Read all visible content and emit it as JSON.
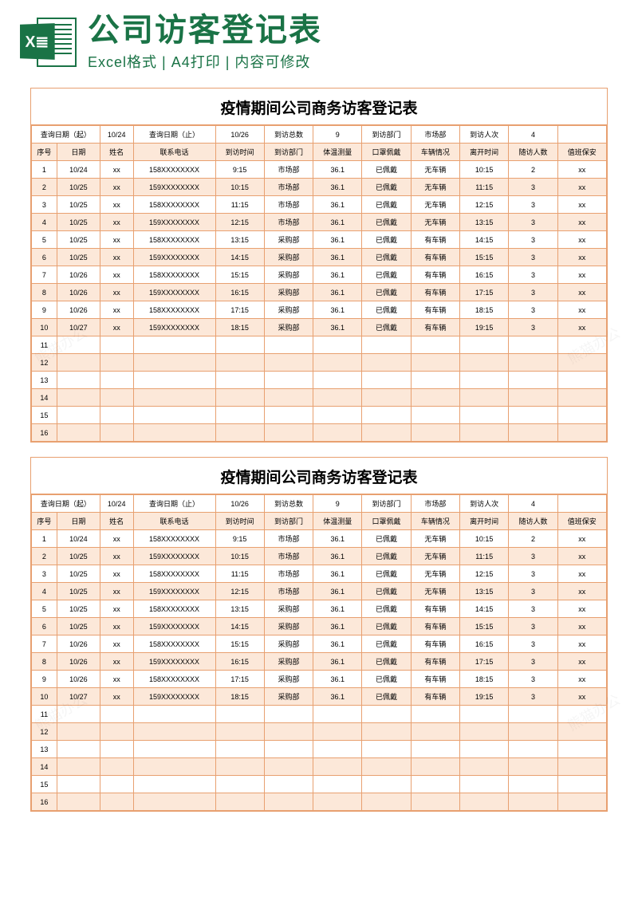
{
  "header": {
    "icon_letter": "X≣",
    "main_title": "公司访客登记表",
    "sub_title": "Excel格式 | A4打印 | 内容可修改"
  },
  "sheet": {
    "title": "疫情期间公司商务访客登记表",
    "summary": {
      "query_start_label": "查询日期（起）",
      "query_start": "10/24",
      "query_end_label": "查询日期（止）",
      "query_end": "10/26",
      "total_visits_label": "到访总数",
      "total_visits": "9",
      "visit_dept_label": "到访部门",
      "visit_dept": "市场部",
      "visit_count_label": "到访人次",
      "visit_count": "4"
    },
    "columns": {
      "seq": "序号",
      "date": "日期",
      "name": "姓名",
      "phone": "联系电话",
      "arrive": "到访时间",
      "dept": "到访部门",
      "temp": "体温测量",
      "mask": "口罩佩戴",
      "car": "车辆情况",
      "leave": "离开时间",
      "ppl": "随访人数",
      "guard": "值班保安"
    },
    "rows": [
      {
        "seq": "1",
        "date": "10/24",
        "name": "xx",
        "phone": "158XXXXXXXX",
        "arrive": "9:15",
        "dept": "市场部",
        "temp": "36.1",
        "mask": "已佩戴",
        "car": "无车辆",
        "leave": "10:15",
        "ppl": "2",
        "guard": "xx"
      },
      {
        "seq": "2",
        "date": "10/25",
        "name": "xx",
        "phone": "159XXXXXXXX",
        "arrive": "10:15",
        "dept": "市场部",
        "temp": "36.1",
        "mask": "已佩戴",
        "car": "无车辆",
        "leave": "11:15",
        "ppl": "3",
        "guard": "xx"
      },
      {
        "seq": "3",
        "date": "10/25",
        "name": "xx",
        "phone": "158XXXXXXXX",
        "arrive": "11:15",
        "dept": "市场部",
        "temp": "36.1",
        "mask": "已佩戴",
        "car": "无车辆",
        "leave": "12:15",
        "ppl": "3",
        "guard": "xx"
      },
      {
        "seq": "4",
        "date": "10/25",
        "name": "xx",
        "phone": "159XXXXXXXX",
        "arrive": "12:15",
        "dept": "市场部",
        "temp": "36.1",
        "mask": "已佩戴",
        "car": "无车辆",
        "leave": "13:15",
        "ppl": "3",
        "guard": "xx"
      },
      {
        "seq": "5",
        "date": "10/25",
        "name": "xx",
        "phone": "158XXXXXXXX",
        "arrive": "13:15",
        "dept": "采购部",
        "temp": "36.1",
        "mask": "已佩戴",
        "car": "有车辆",
        "leave": "14:15",
        "ppl": "3",
        "guard": "xx"
      },
      {
        "seq": "6",
        "date": "10/25",
        "name": "xx",
        "phone": "159XXXXXXXX",
        "arrive": "14:15",
        "dept": "采购部",
        "temp": "36.1",
        "mask": "已佩戴",
        "car": "有车辆",
        "leave": "15:15",
        "ppl": "3",
        "guard": "xx"
      },
      {
        "seq": "7",
        "date": "10/26",
        "name": "xx",
        "phone": "158XXXXXXXX",
        "arrive": "15:15",
        "dept": "采购部",
        "temp": "36.1",
        "mask": "已佩戴",
        "car": "有车辆",
        "leave": "16:15",
        "ppl": "3",
        "guard": "xx"
      },
      {
        "seq": "8",
        "date": "10/26",
        "name": "xx",
        "phone": "159XXXXXXXX",
        "arrive": "16:15",
        "dept": "采购部",
        "temp": "36.1",
        "mask": "已佩戴",
        "car": "有车辆",
        "leave": "17:15",
        "ppl": "3",
        "guard": "xx"
      },
      {
        "seq": "9",
        "date": "10/26",
        "name": "xx",
        "phone": "158XXXXXXXX",
        "arrive": "17:15",
        "dept": "采购部",
        "temp": "36.1",
        "mask": "已佩戴",
        "car": "有车辆",
        "leave": "18:15",
        "ppl": "3",
        "guard": "xx"
      },
      {
        "seq": "10",
        "date": "10/27",
        "name": "xx",
        "phone": "159XXXXXXXX",
        "arrive": "18:15",
        "dept": "采购部",
        "temp": "36.1",
        "mask": "已佩戴",
        "car": "有车辆",
        "leave": "19:15",
        "ppl": "3",
        "guard": "xx"
      },
      {
        "seq": "11",
        "date": "",
        "name": "",
        "phone": "",
        "arrive": "",
        "dept": "",
        "temp": "",
        "mask": "",
        "car": "",
        "leave": "",
        "ppl": "",
        "guard": ""
      },
      {
        "seq": "12",
        "date": "",
        "name": "",
        "phone": "",
        "arrive": "",
        "dept": "",
        "temp": "",
        "mask": "",
        "car": "",
        "leave": "",
        "ppl": "",
        "guard": ""
      },
      {
        "seq": "13",
        "date": "",
        "name": "",
        "phone": "",
        "arrive": "",
        "dept": "",
        "temp": "",
        "mask": "",
        "car": "",
        "leave": "",
        "ppl": "",
        "guard": ""
      },
      {
        "seq": "14",
        "date": "",
        "name": "",
        "phone": "",
        "arrive": "",
        "dept": "",
        "temp": "",
        "mask": "",
        "car": "",
        "leave": "",
        "ppl": "",
        "guard": ""
      },
      {
        "seq": "15",
        "date": "",
        "name": "",
        "phone": "",
        "arrive": "",
        "dept": "",
        "temp": "",
        "mask": "",
        "car": "",
        "leave": "",
        "ppl": "",
        "guard": ""
      },
      {
        "seq": "16",
        "date": "",
        "name": "",
        "phone": "",
        "arrive": "",
        "dept": "",
        "temp": "",
        "mask": "",
        "car": "",
        "leave": "",
        "ppl": "",
        "guard": ""
      }
    ]
  },
  "watermark": "熊猫办公"
}
